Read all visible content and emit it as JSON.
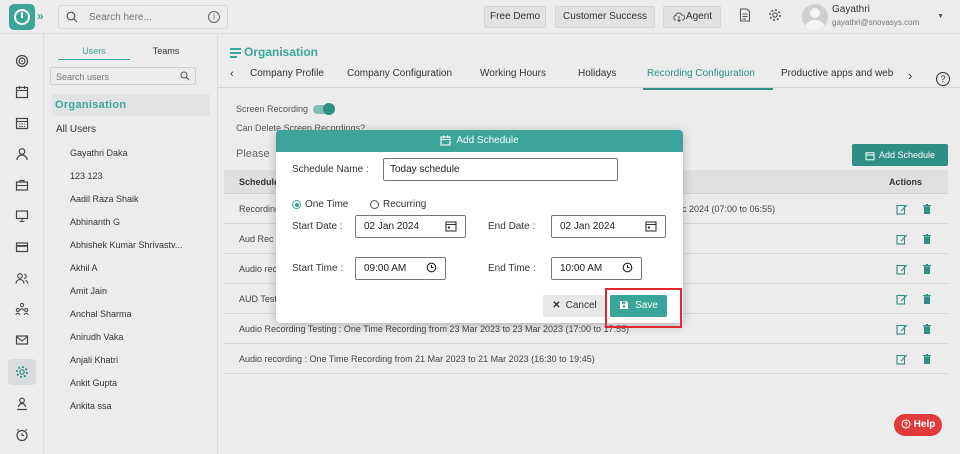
{
  "topbar": {
    "search_placeholder": "Search here...",
    "buttons": [
      "Free Demo",
      "Customer Success",
      "Agent"
    ],
    "user_name": "Gayathri",
    "user_email": "gayathri@snovasys.com"
  },
  "rail": {
    "icons": [
      "target-icon",
      "calendar-icon",
      "calendar-grid-icon",
      "user-icon",
      "briefcase-icon",
      "monitor-icon",
      "card-icon",
      "users-icon",
      "org-chart-icon",
      "mail-icon",
      "settings-icon",
      "person-stand-icon",
      "clock-icon"
    ],
    "active": "settings-icon"
  },
  "left_panel": {
    "tabs": [
      "Users",
      "Teams"
    ],
    "active_tab": "Users",
    "search_placeholder": "Search users",
    "org_heading": "Organisation",
    "all_users": "All Users",
    "users": [
      "Gayathri Daka",
      "123 123",
      "Aadil Raza Shaik",
      "Abhinanth G",
      "Abhishek Kumar Shrivastv...",
      "Akhil A",
      "Amit Jain",
      "Anchal Sharma",
      "Anirudh Vaka",
      "Anjali Khatri",
      "Ankit Gupta",
      "Ankita ssa"
    ]
  },
  "main": {
    "breadcrumb": "Organisation",
    "tabs": [
      "Company Profile",
      "Company Configuration",
      "Working Hours",
      "Holidays",
      "Recording Configuration",
      "Productive apps and web"
    ],
    "active_tab": "Recording Configuration",
    "screen_recording_label": "Screen Recording",
    "can_delete_label": "Can Delete Screen Recordings?",
    "please_label": "Please",
    "add_schedule_button": "Add Schedule",
    "table": {
      "headers": [
        "Schedule",
        "Actions"
      ],
      "rows": [
        "Recording",
        "Aud Rec",
        "Audio reco",
        "AUD Testi",
        "Audio Recording Testing : One Time Recording from 23 Mar 2023 to 23 Mar 2023 (17:00 to 17:55)",
        "Audio recording : One Time Recording from 21 Mar 2023 to 21 Mar 2023 (16:30 to 19:45)"
      ],
      "row1_tail": "c 2024 (07:00 to 06:55)"
    }
  },
  "modal": {
    "title": "Add Schedule",
    "schedule_name_label": "Schedule Name :",
    "schedule_name_value": "Today schedule",
    "radio_one_time": "One Time",
    "radio_recurring": "Recurring",
    "selected_radio": "One Time",
    "start_date_label": "Start Date :",
    "start_date_value": "02 Jan 2024",
    "end_date_label": "End Date :",
    "end_date_value": "02 Jan 2024",
    "start_time_label": "Start Time :",
    "start_time_value": "09:00 AM",
    "end_time_label": "End Time :",
    "end_time_value": "10:00 AM",
    "cancel_button": "Cancel",
    "save_button": "Save"
  },
  "help_button": "Help",
  "colors": {
    "accent": "#3aa598",
    "accent_dark": "#2f8f84",
    "highlight": "#e0282e",
    "help": "#e03a3a"
  }
}
